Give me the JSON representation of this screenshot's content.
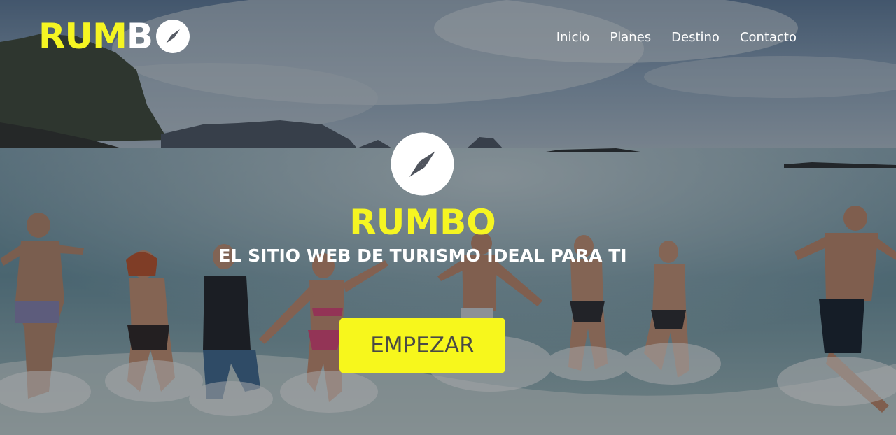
{
  "brand": {
    "logo_part1": "RUM",
    "logo_part2": "B",
    "logo_icon": "compass-icon",
    "accent_color": "#f5f522"
  },
  "nav": {
    "items": [
      "Inicio",
      "Planes",
      "Destino",
      "Contacto"
    ]
  },
  "hero": {
    "icon": "compass-icon",
    "title": "RUMBO",
    "subtitle": "EL SITIO WEB DE TURISMO IDEAL PARA TI",
    "cta_label": "EMPEZAR",
    "cta_color": "#f7f71c"
  }
}
